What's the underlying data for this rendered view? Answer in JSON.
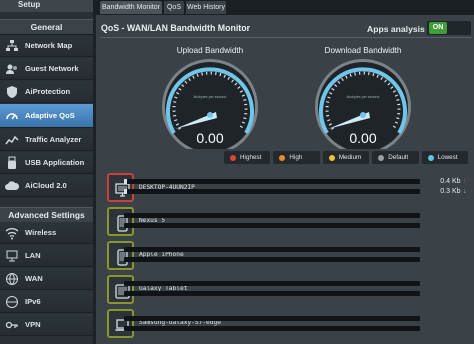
{
  "sidebar": {
    "setup_label": "Setup",
    "general_label": "General",
    "advanced_label": "Advanced Settings",
    "general_items": [
      {
        "label": "Network Map",
        "icon": "network-map-icon"
      },
      {
        "label": "Guest Network",
        "icon": "guest-network-icon"
      },
      {
        "label": "AiProtection",
        "icon": "shield-icon"
      },
      {
        "label": "Adaptive QoS",
        "icon": "qos-icon",
        "active": true
      },
      {
        "label": "Traffic Analyzer",
        "icon": "traffic-analyzer-icon"
      },
      {
        "label": "USB Application",
        "icon": "usb-icon"
      },
      {
        "label": "AiCloud 2.0",
        "icon": "cloud-icon"
      }
    ],
    "advanced_items": [
      {
        "label": "Wireless",
        "icon": "wireless-icon"
      },
      {
        "label": "LAN",
        "icon": "lan-icon"
      },
      {
        "label": "WAN",
        "icon": "wan-icon"
      },
      {
        "label": "IPv6",
        "icon": "ipv6-icon"
      },
      {
        "label": "VPN",
        "icon": "vpn-icon"
      }
    ]
  },
  "tabs": [
    "Bandwidth Monitor",
    "QoS",
    "Web History"
  ],
  "header": {
    "title": "QoS - WAN/LAN Bandwidth Monitor",
    "apps_analysis_label": "Apps analysis",
    "apps_analysis_state": "ON"
  },
  "gauges": [
    {
      "title": "Upload Bandwidth",
      "value": "0.00",
      "unit_label": "kilobytes per second"
    },
    {
      "title": "Download Bandwidth",
      "value": "0.00",
      "unit_label": "kilobytes per second"
    }
  ],
  "priority_legend": [
    {
      "label": "Highest",
      "color": "#e0443b"
    },
    {
      "label": "High",
      "color": "#ee8a2a"
    },
    {
      "label": "Medium",
      "color": "#e8c43a"
    },
    {
      "label": "Default",
      "color": "#9aa0a4"
    },
    {
      "label": "Lowest",
      "color": "#5fc3ea"
    }
  ],
  "clients": [
    {
      "name": "DESKTOP-4UUN2IP",
      "device": "desktop-icon",
      "border_color": "#c9413b",
      "upload": "0.4",
      "upload_unit": "Kb",
      "download": "0.3",
      "download_unit": "Kb",
      "upload_fill": 0.01,
      "download_fill": 0.01
    },
    {
      "name": "Nexus 5",
      "device": "phone-icon",
      "border_color": "#8a9430"
    },
    {
      "name": "Apple iPhone",
      "device": "phone-icon",
      "border_color": "#8a9430"
    },
    {
      "name": "Galaxy Tablet",
      "device": "tablet-icon",
      "border_color": "#8a9430"
    },
    {
      "name": "Samsung-Galaxy-S7-edge",
      "device": "laptop-icon",
      "border_color": "#8a9430"
    }
  ]
}
